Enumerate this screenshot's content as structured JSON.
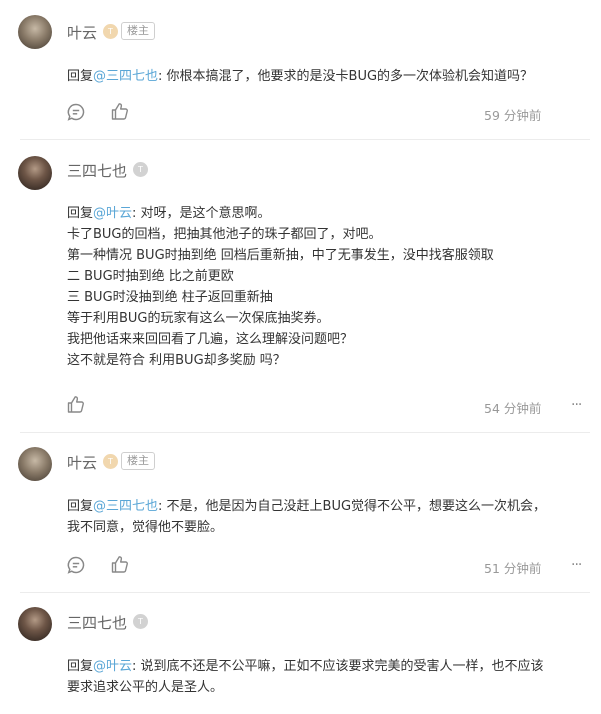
{
  "comments": [
    {
      "author": "叶云",
      "level_badge": "T",
      "tag": "楼主",
      "reply_prefix": "回复",
      "reply_to": "@三四七也",
      "lines": [
        "你根本搞混了，他要求的是没卡BUG的多一次体验机会知道吗？"
      ],
      "time": "59 分钟前"
    },
    {
      "author": "三四七也",
      "level_badge": "T",
      "reply_prefix": "回复",
      "reply_to": "@叶云",
      "lines": [
        "对呀，是这个意思啊。",
        "卡了BUG的回档，把抽其他池子的珠子都回了，对吧。",
        "第一种情况 BUG时抽到绝 回档后重新抽，中了无事发生，没中找客服领取",
        "二 BUG时抽到绝 比之前更欧",
        "三 BUG时没抽到绝 柱子返回重新抽",
        "等于利用BUG的玩家有这么一次保底抽奖券。",
        "我把他话来来回回看了几遍，这么理解没问题吧？",
        "这不就是符合 利用BUG却多奖励 吗？"
      ],
      "time": "54 分钟前",
      "more": "···"
    },
    {
      "author": "叶云",
      "level_badge": "T",
      "tag": "楼主",
      "reply_prefix": "回复",
      "reply_to": "@三四七也",
      "lines": [
        "不是，他是因为自己没赶上BUG觉得不公平，想要这么一次机会，",
        "我不同意，觉得他不要脸。"
      ],
      "time": "51 分钟前",
      "more": "···"
    },
    {
      "author": "三四七也",
      "level_badge": "T",
      "reply_prefix": "回复",
      "reply_to": "@叶云",
      "lines": [
        "说到底不还是不公平嘛，正如不应该要求完美的受害人一样，也不应该",
        "要求追求公平的人是圣人。"
      ]
    }
  ]
}
